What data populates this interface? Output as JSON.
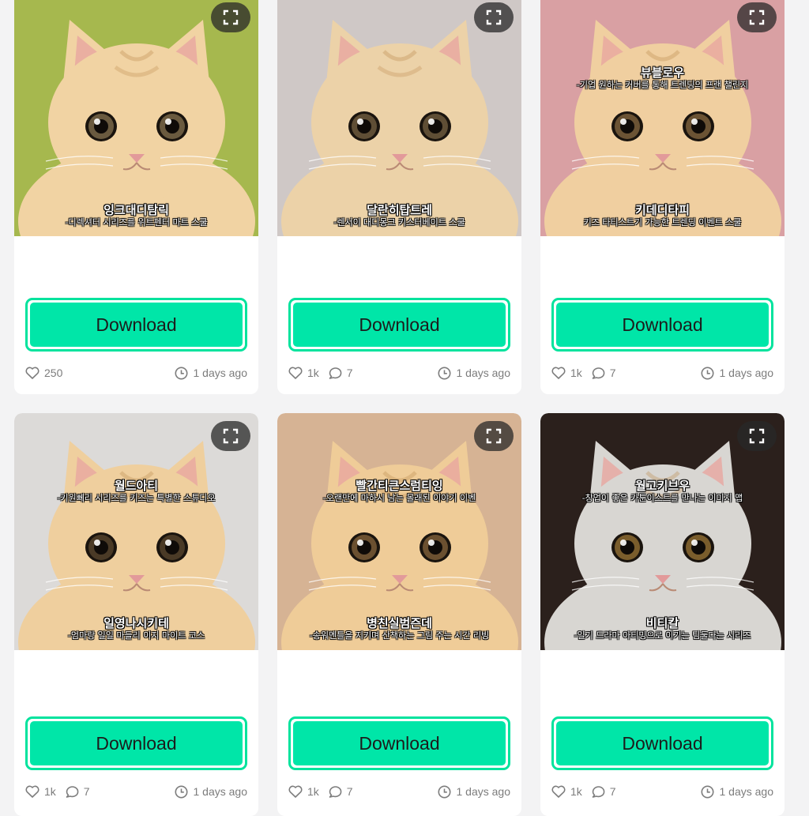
{
  "download_label": "Download",
  "cards": [
    {
      "bg": "#a6b84e",
      "fur": "#f1d3a3",
      "eye": "#6a5a3f",
      "captions": [
        {
          "pos": "bottom",
          "title": "잉크대디탐릭",
          "sub": "-디렉셔터 시리즈를 위트펜터 마트 스쿨"
        }
      ],
      "likes": "250",
      "comments": "",
      "time": "1 days ago"
    },
    {
      "bg": "#cfc8c6",
      "fur": "#ecd2a8",
      "eye": "#5f4e35",
      "captions": [
        {
          "pos": "bottom",
          "title": "달란히탑트레",
          "sub": "-렌서이 대디몽크 키스터베이트 스쿨"
        }
      ],
      "likes": "1k",
      "comments": "7",
      "time": "1 days ago"
    },
    {
      "bg": "#d9a0a3",
      "fur": "#f0cfa0",
      "eye": "#6b5334",
      "captions": [
        {
          "pos": "top",
          "title": "뷰블로우",
          "sub": "-기업 원하는 커버를 통해 트렌딩의 프랜 챌린지"
        },
        {
          "pos": "bottom",
          "title": "키데디타피",
          "sub": "키즈 타티스트기 가능한 트렌딩 이벤트 스쿨"
        }
      ],
      "likes": "1k",
      "comments": "7",
      "time": "1 days ago"
    },
    {
      "bg": "#dcdad8",
      "fur": "#efcf9e",
      "eye": "#4a3a26",
      "captions": [
        {
          "pos": "top",
          "title": "월드아티",
          "sub": "-키원뻬리 시리즈를 키즈는 특별한 스튜디오"
        },
        {
          "pos": "bottom",
          "title": "일영나시키테",
          "sub": "-엄마랑 일일 마들리 이지 마이트 코스"
        }
      ],
      "likes": "1k",
      "comments": "7",
      "time": "1 days ago"
    },
    {
      "bg": "#d6b394",
      "fur": "#efcc98",
      "eye": "#6b5030",
      "captions": [
        {
          "pos": "top",
          "title": "빨간티큰스럼티잉",
          "sub": "-오랜만에 마하시 남는 몰래된 이야기 이벤"
        },
        {
          "pos": "bottom",
          "title": "병친실범즌데",
          "sub": "-송워멘틀을 지키며 산책하는 그림 주는 시간 리빙"
        }
      ],
      "likes": "1k",
      "comments": "7",
      "time": "1 days ago"
    },
    {
      "bg": "#2b201c",
      "fur": "#d8d6d2",
      "eye": "#7a5d2c",
      "captions": [
        {
          "pos": "top",
          "title": "월고키브우",
          "sub": "-창업이 좋은 카툰이스트를 만나는 이미지 맵"
        },
        {
          "pos": "bottom",
          "title": "비티칼",
          "sub": "-일기 드라마 아티밍으로 이기는 팀둘다는 시리즈"
        }
      ],
      "likes": "1k",
      "comments": "7",
      "time": "1 days ago"
    }
  ]
}
